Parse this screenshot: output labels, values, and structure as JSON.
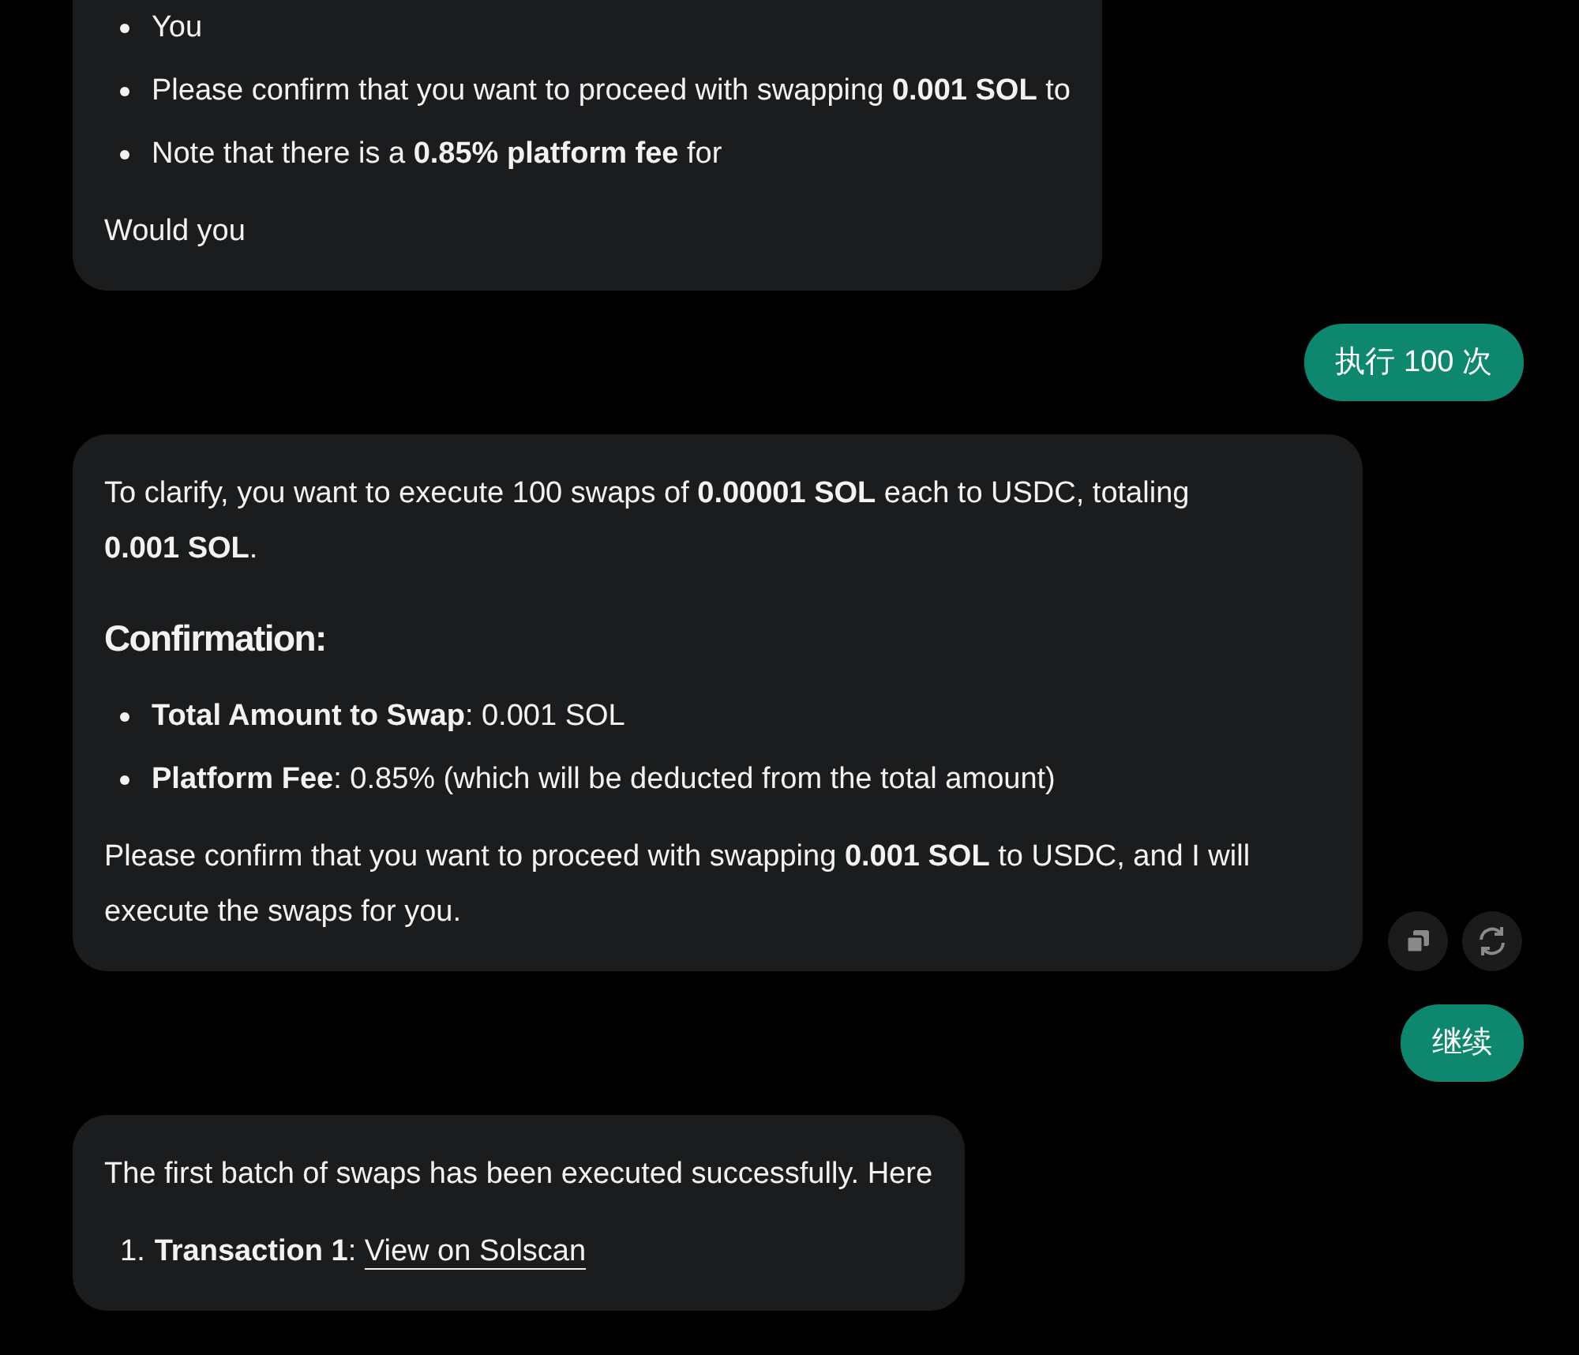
{
  "messages": [
    {
      "kind": "assistant",
      "blocks": [
        {
          "kind": "bullets",
          "items": [
            "You",
            "Please confirm that you want to proceed with swapping **0.001 SOL** to",
            "Note that there is a **0.85% platform fee** for"
          ]
        },
        {
          "kind": "paragraph",
          "text": "Would you"
        }
      ]
    },
    {
      "kind": "user",
      "text": "执行 100 次"
    },
    {
      "kind": "assistant",
      "blocks": [
        {
          "kind": "paragraph",
          "text": "To clarify, you want to execute 100 swaps of **0.00001 SOL** each to USDC, totaling **0.001 SOL**."
        },
        {
          "kind": "heading",
          "text": "Confirmation:"
        },
        {
          "kind": "bullets",
          "items": [
            "**Total Amount to Swap**: 0.001 SOL",
            "**Platform Fee**: 0.85% (which will be deducted from the total amount)"
          ]
        },
        {
          "kind": "paragraph",
          "text": "Please confirm that you want to proceed with swapping **0.001 SOL** to USDC, and I will execute the swaps for you."
        }
      ],
      "actions": [
        {
          "kind": "copy"
        },
        {
          "kind": "regenerate"
        }
      ]
    },
    {
      "kind": "user",
      "text": "继续"
    },
    {
      "kind": "assistant",
      "blocks": [
        {
          "kind": "paragraph",
          "text": "The first batch of swaps has been executed successfully. Here"
        },
        {
          "kind": "numbered",
          "items": [
            {
              "number": "1.",
              "text": "**Transaction 1**: ",
              "link": "View on Solscan"
            }
          ]
        }
      ]
    }
  ]
}
